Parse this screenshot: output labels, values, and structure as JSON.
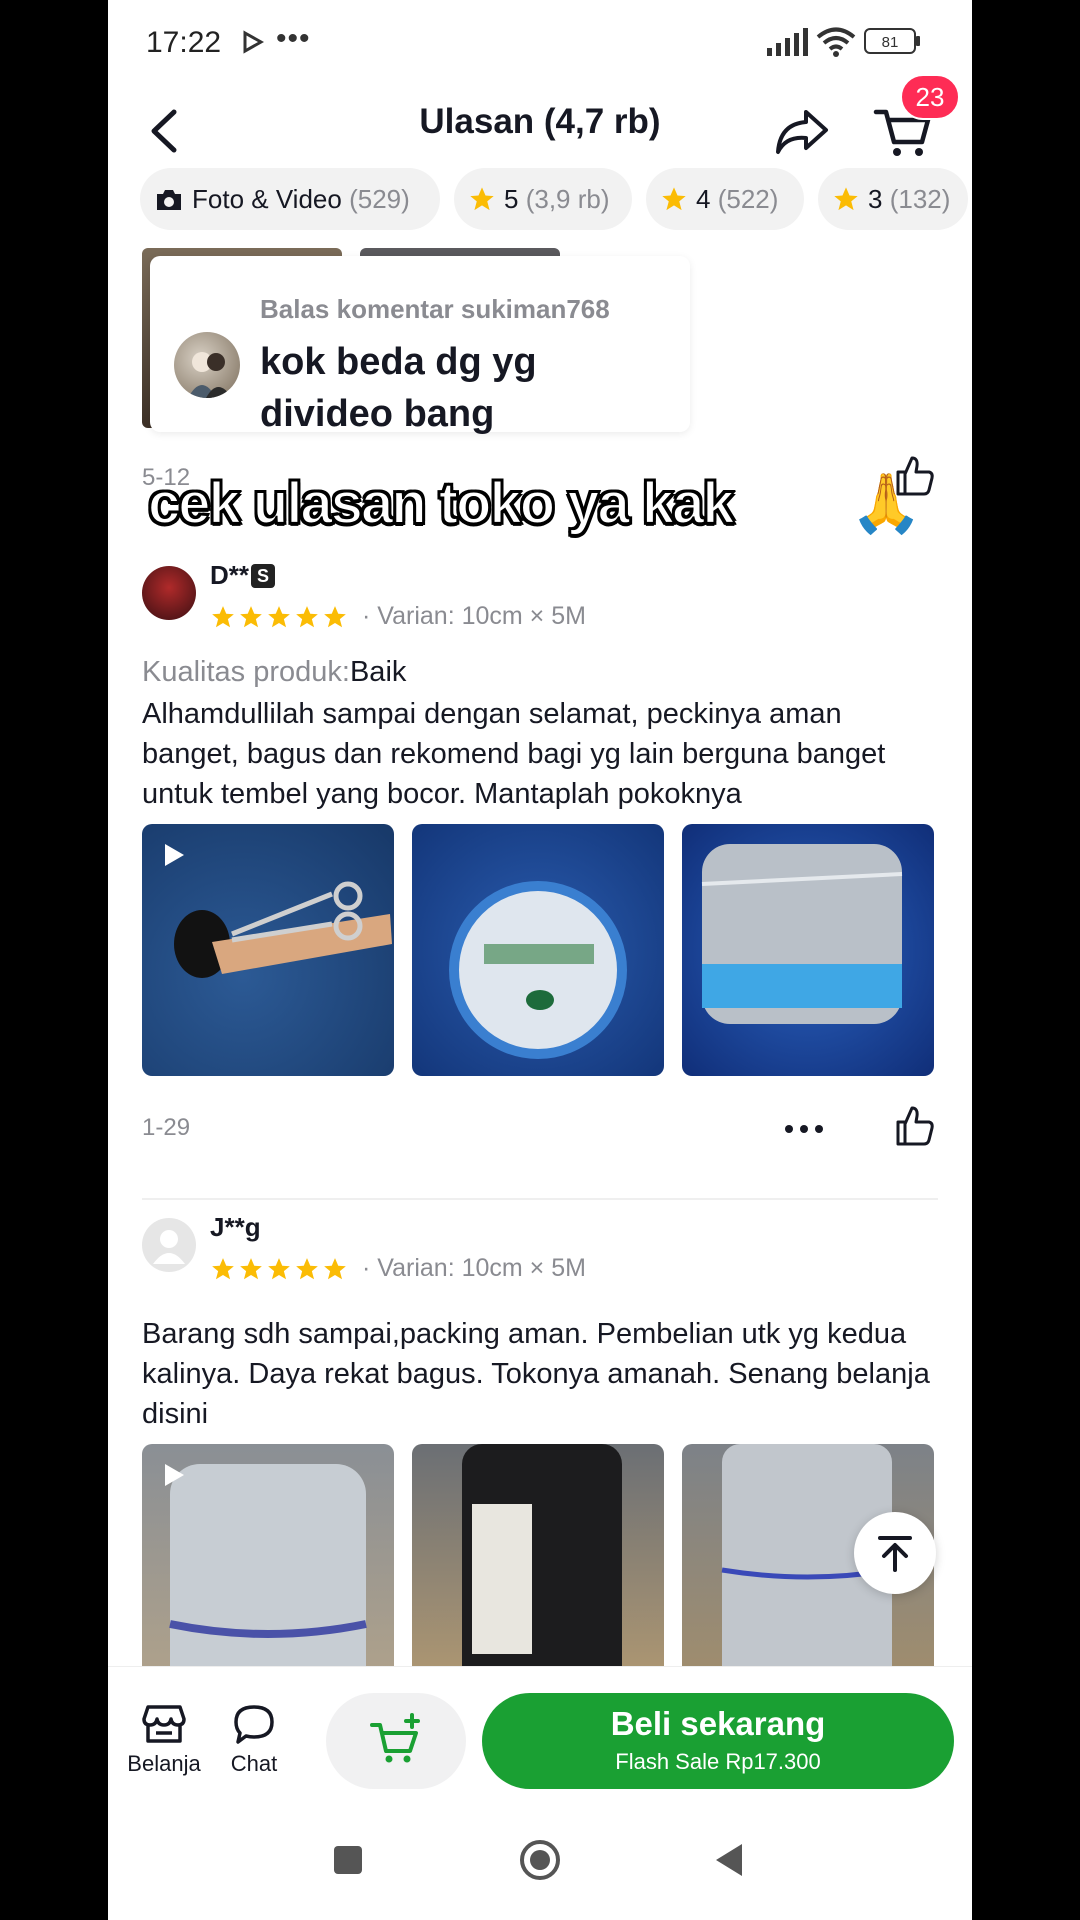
{
  "status_bar": {
    "time": "17:22",
    "dots": "•••",
    "battery": "81"
  },
  "header": {
    "title": "Ulasan (4,7 rb)",
    "cart_badge": "23"
  },
  "filters": [
    {
      "label": "Foto & Video",
      "count": "(529)",
      "icon": "camera-icon"
    },
    {
      "label": "5",
      "count": "(3,9 rb)",
      "icon": "star-icon"
    },
    {
      "label": "4",
      "count": "(522)",
      "icon": "star-icon"
    },
    {
      "label": "3",
      "count": "(132)",
      "icon": "star-icon"
    }
  ],
  "reply_popup": {
    "label": "Balas komentar sukiman768",
    "text": "kok beda dg yg divideo bang"
  },
  "previous_review": {
    "date": "5-12"
  },
  "overlay_caption": "cek ulasan toko ya kak",
  "overlay_emoji": "🙏",
  "reviews": [
    {
      "name": "D**",
      "badge": "S",
      "rating": 5,
      "variant": "Varian: 10cm × 5M",
      "quality_label": "Kualitas produk:",
      "quality_value": "Baik",
      "text": "Alhamdullilah sampai dengan selamat, peckinya aman banget, bagus dan rekomend bagi yg lain berguna banget untuk tembel yang bocor. Mantaplah pokoknya",
      "date": "1-29"
    },
    {
      "name": "J**g",
      "rating": 5,
      "variant": "Varian: 10cm × 5M",
      "text": "Barang sdh sampai,packing aman. Pembelian utk yg kedua kalinya. Daya rekat bagus. Tokonya amanah. Senang belanja disini"
    }
  ],
  "bottom_bar": {
    "shop_label": "Belanja",
    "chat_label": "Chat",
    "buy_label": "Beli sekarang",
    "buy_sub": "Flash Sale Rp17.300"
  },
  "colors": {
    "accent": "#1aa033",
    "badge": "#fe2c55",
    "star": "#fbbc05"
  }
}
